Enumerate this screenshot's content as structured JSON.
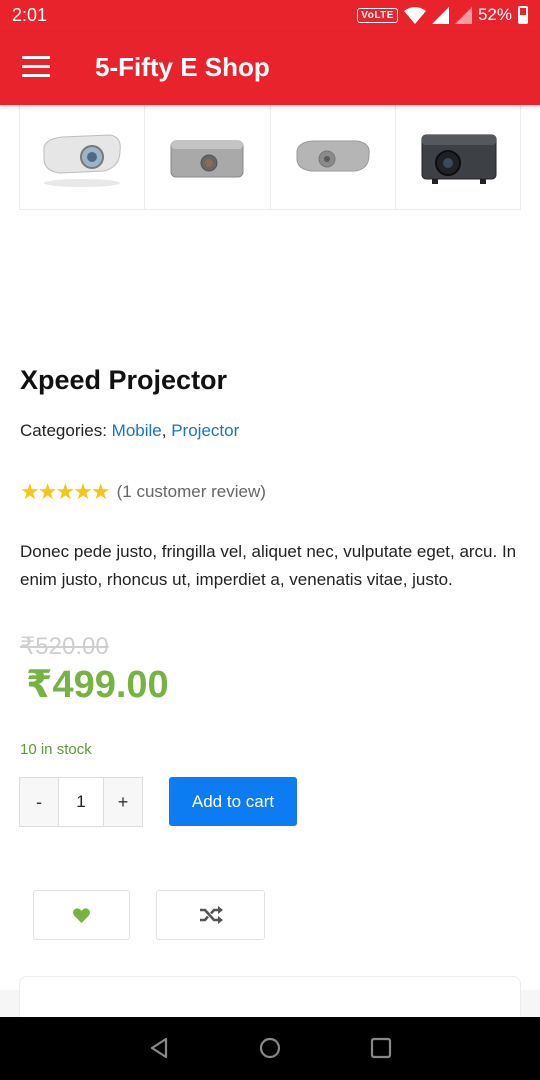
{
  "status_bar": {
    "time": "2:01",
    "network_badge": "VoLTE",
    "battery": "52%"
  },
  "app_bar": {
    "title": "5-Fifty E Shop",
    "menu_icon": "hamburger-menu-icon"
  },
  "gallery": {
    "thumbnails": [
      "projector-thumb-1",
      "projector-thumb-2",
      "projector-thumb-3",
      "projector-thumb-4"
    ]
  },
  "product": {
    "title": "Xpeed Projector",
    "categories_label": "Categories: ",
    "categories": [
      "Mobile",
      "Projector"
    ],
    "separator": ", ",
    "rating": 5,
    "stars": "★★★★★",
    "review_text": "(1 customer review)",
    "description": "Donec pede justo, fringilla vel, aliquet nec, vulputate eget, arcu. In enim justo, rhoncus ut, imperdiet a, venenatis vitae, justo.",
    "old_price": "₹520.00",
    "price": "₹499.00",
    "stock": "10 in stock"
  },
  "cart": {
    "minus": "-",
    "quantity": "1",
    "plus": "+",
    "add_to_cart": "Add to cart"
  },
  "actions": {
    "wishlist_icon": "heart-icon",
    "compare_icon": "shuffle-icon"
  },
  "colors": {
    "brand": "#e8232b",
    "accent_blue": "#0d7cf2",
    "price_green": "#76b343",
    "link": "#1a73c8",
    "star": "#f5c518"
  }
}
